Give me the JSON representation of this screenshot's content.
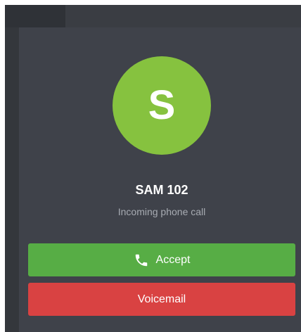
{
  "caller": {
    "avatar_initial": "S",
    "name": "SAM 102",
    "status": "Incoming phone call"
  },
  "actions": {
    "accept_label": "Accept",
    "voicemail_label": "Voicemail"
  },
  "icons": {
    "accept_icon": "phone-icon"
  },
  "colors": {
    "avatar": "#86c23f",
    "accept": "#57ad45",
    "voicemail": "#d94242",
    "panel": "#3f424a"
  }
}
